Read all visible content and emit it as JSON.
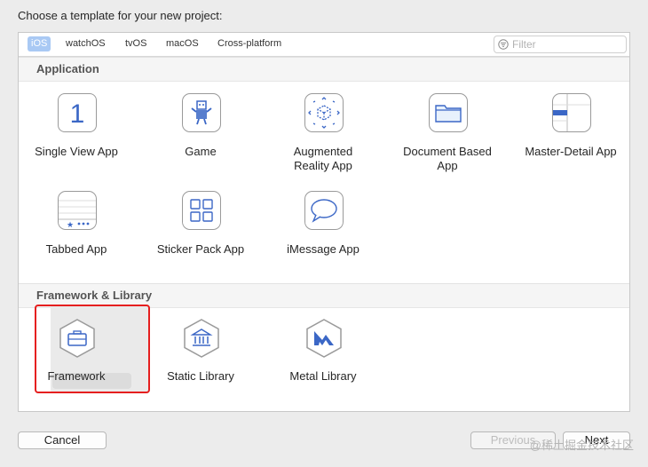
{
  "prompt": "Choose a template for your new project:",
  "tabs": [
    {
      "label": "iOS",
      "active": true
    },
    {
      "label": "watchOS",
      "active": false
    },
    {
      "label": "tvOS",
      "active": false
    },
    {
      "label": "macOS",
      "active": false
    },
    {
      "label": "Cross-platform",
      "active": false
    }
  ],
  "filter": {
    "placeholder": "Filter"
  },
  "sections": {
    "application": {
      "title": "Application",
      "items": [
        {
          "label": "Single View App",
          "icon": "single-view-icon"
        },
        {
          "label": "Game",
          "icon": "game-icon"
        },
        {
          "label": "Augmented Reality App",
          "icon": "ar-icon"
        },
        {
          "label": "Document Based App",
          "icon": "folder-icon"
        },
        {
          "label": "Master-Detail App",
          "icon": "master-detail-icon"
        },
        {
          "label": "Tabbed App",
          "icon": "tabbed-icon"
        },
        {
          "label": "Sticker Pack App",
          "icon": "sticker-grid-icon"
        },
        {
          "label": "iMessage App",
          "icon": "message-bubble-icon"
        }
      ]
    },
    "framework": {
      "title": "Framework & Library",
      "items": [
        {
          "label": "Framework",
          "icon": "toolbox-icon",
          "selected": true
        },
        {
          "label": "Static Library",
          "icon": "library-building-icon"
        },
        {
          "label": "Metal Library",
          "icon": "metal-icon"
        }
      ]
    }
  },
  "buttons": {
    "cancel": "Cancel",
    "previous": "Previous",
    "next": "Next"
  },
  "watermark": "@稀土掘金技术社区",
  "colors": {
    "accent": "#a9c9f4",
    "icon_blue": "#3b67c6",
    "highlight": "#e51f1f"
  }
}
